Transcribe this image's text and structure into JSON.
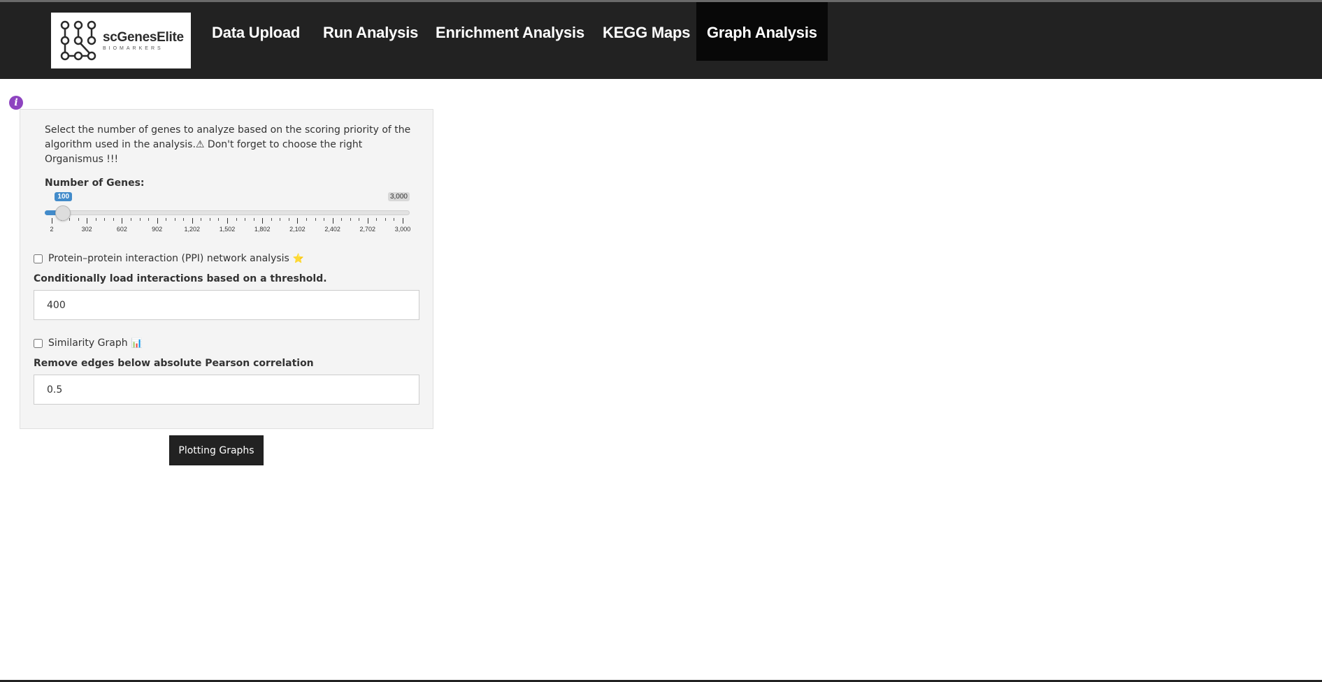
{
  "logo": {
    "name": "scGenesElite",
    "sub": "BIOMARKERS"
  },
  "nav": {
    "items": [
      {
        "label": "Data Upload",
        "active": false
      },
      {
        "label": "Run Analysis",
        "active": false
      },
      {
        "label": "Enrichment Analysis",
        "active": false
      },
      {
        "label": "KEGG Maps",
        "active": false
      },
      {
        "label": "Graph Analysis",
        "active": true
      }
    ]
  },
  "panel": {
    "description": "Select the number of genes to analyze based on the scoring priority of the algorithm used in the analysis.⚠ Don't forget to choose the right Organismus !!!",
    "genes_label": "Number of Genes:",
    "slider": {
      "value_label": "100",
      "max_label": "3,000",
      "min": 2,
      "max": 3000,
      "value": 100,
      "ticks": [
        "2",
        "302",
        "602",
        "902",
        "1,202",
        "1,502",
        "1,802",
        "2,102",
        "2,402",
        "2,702",
        "3,000"
      ]
    },
    "ppi_label": "Protein–protein interaction (PPI) network analysis",
    "ppi_checked": false,
    "threshold_label": "Conditionally load interactions based on a threshold.",
    "threshold_value": "400",
    "similarity_label": "Similarity Graph",
    "similarity_checked": false,
    "pearson_label": "Remove edges below absolute Pearson correlation",
    "pearson_value": "0.5"
  },
  "plot_button": "Plotting Graphs",
  "colors": {
    "navbar": "#222222",
    "accent": "#428bca",
    "info": "#8e44c0"
  }
}
